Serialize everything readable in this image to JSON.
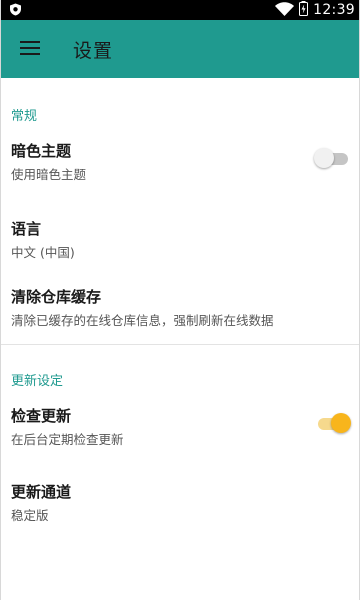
{
  "status_bar": {
    "time": "12:39",
    "icons": [
      "app-notification-icon",
      "wifi-icon",
      "battery-icon"
    ]
  },
  "toolbar": {
    "title": "设置",
    "menu_icon": "hamburger-menu-icon"
  },
  "sections": [
    {
      "header": "常规",
      "items": [
        {
          "title": "暗色主题",
          "summary": "使用暗色主题",
          "switch": "off"
        },
        {
          "title": "语言",
          "summary": "中文 (中国)"
        },
        {
          "title": "清除仓库缓存",
          "summary": "清除已缓存的在线仓库信息，强制刷新在线数据"
        }
      ]
    },
    {
      "header": "更新设定",
      "items": [
        {
          "title": "检查更新",
          "summary": "在后台定期检查更新",
          "switch": "on"
        },
        {
          "title": "更新通道",
          "summary": "稳定版"
        }
      ]
    }
  ],
  "colors": {
    "primary": "#1f9a8f",
    "accent": "#f8b51c",
    "status_bar": "#000000"
  }
}
